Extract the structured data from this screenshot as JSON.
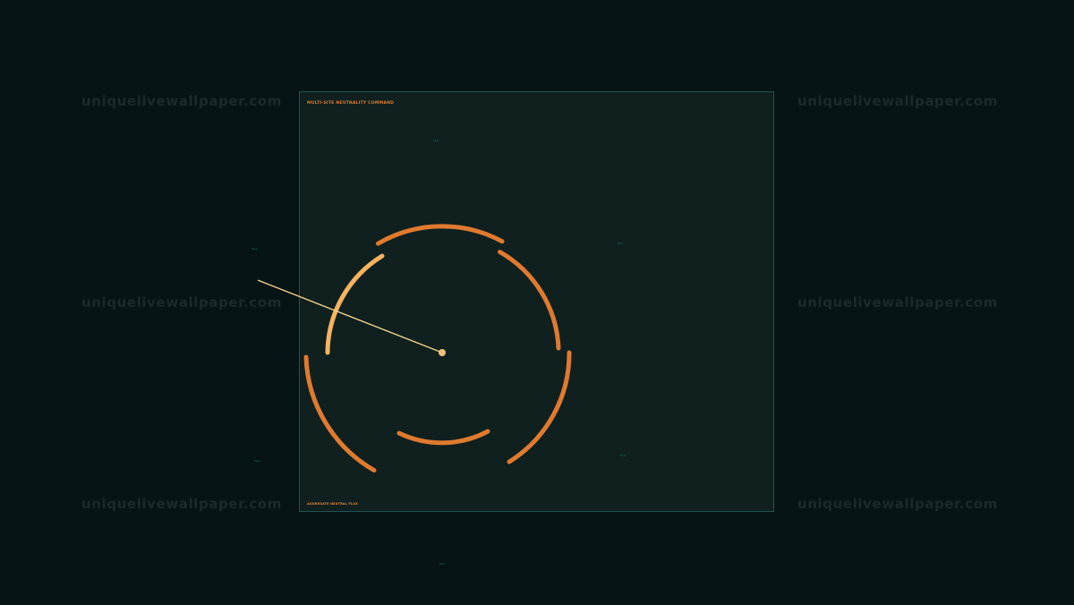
{
  "watermark": {
    "text": "uniquelivewallpaper.com"
  },
  "panel": {
    "title": "MULTI-SITE NEUTRALITY COMMAND",
    "footer": "AGGREGATE NEUTRAL FLUX"
  },
  "tick_labels": {
    "t1": "TL-a",
    "t2": "TL-b",
    "t3": "TL-c",
    "t4": "TL-d",
    "t5": "TL-e",
    "t6": "TL-f"
  },
  "colors": {
    "background": "#071415",
    "panel": "#0f201f",
    "panel_border": "#1f5350",
    "arc_orange": "#e07a2e",
    "arc_highlight": "#f7b35f",
    "needle": "#f3d28a",
    "tick_teal": "#1f8c7c"
  },
  "gauge": {
    "highlighted_segment": "upper-left"
  }
}
